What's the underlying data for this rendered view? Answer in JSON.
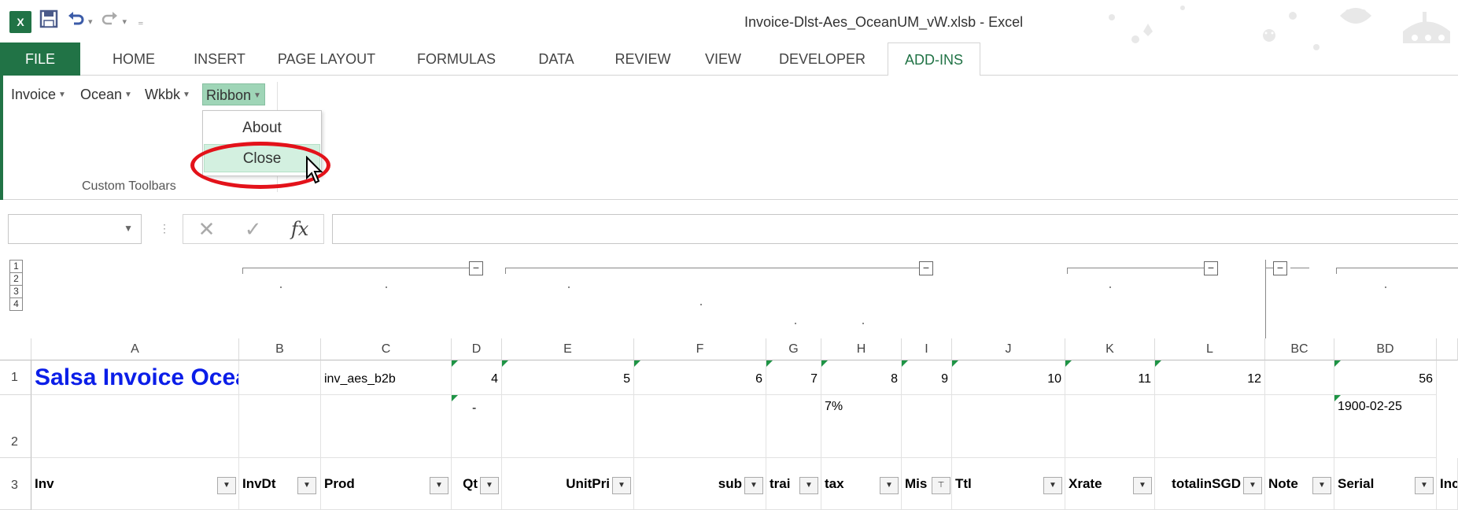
{
  "window": {
    "title": "Invoice-Dlst-Aes_OceanUM_vW.xlsb - Excel",
    "app_icon": "X"
  },
  "tabs": [
    "FILE",
    "HOME",
    "INSERT",
    "PAGE LAYOUT",
    "FORMULAS",
    "DATA",
    "REVIEW",
    "VIEW",
    "DEVELOPER",
    "ADD-INS"
  ],
  "active_tab": "ADD-INS",
  "ribbon": {
    "menus": [
      "Invoice",
      "Ocean",
      "Wkbk",
      "Ribbon"
    ],
    "open_menu": "Ribbon",
    "group_label": "Custom Toolbars",
    "dropdown_items": [
      "About",
      "Close"
    ],
    "highlighted_item": "Close"
  },
  "formula_bar": {
    "name_box": "",
    "formula": "",
    "fx_label": "fx"
  },
  "outline": {
    "levels": [
      "1",
      "2",
      "3",
      "4"
    ]
  },
  "columns": [
    "A",
    "B",
    "C",
    "D",
    "E",
    "F",
    "G",
    "H",
    "I",
    "J",
    "K",
    "L",
    "BC",
    "BD"
  ],
  "rows": {
    "row_numbers": [
      "1",
      "2",
      "3"
    ],
    "row1": {
      "A": "Salsa Invoice Ocean",
      "C": "inv_aes_b2b",
      "D": "4",
      "E": "5",
      "F": "6",
      "G": "7",
      "H": "8",
      "I": "9",
      "J": "10",
      "K": "11",
      "L": "12",
      "BD": "56"
    },
    "row2": {
      "D": "-",
      "H": "7%",
      "BD": "1900-02-25"
    },
    "row3": {
      "A": "Inv",
      "B": "InvDt",
      "C": "Prod",
      "D": "Qt",
      "E": "UnitPri",
      "F": "sub",
      "G": "trai",
      "H": "tax",
      "I": "Mis",
      "J": "Ttl",
      "K": "Xrate",
      "L": "totalinSGD",
      "BC": "Note",
      "BD": "Serial",
      "BE": "Inc"
    }
  },
  "colors": {
    "excel_green": "#217346",
    "title_blue": "#0b1ee8",
    "highlight_red": "#e3121a",
    "menu_open": "#9fd5b7"
  }
}
